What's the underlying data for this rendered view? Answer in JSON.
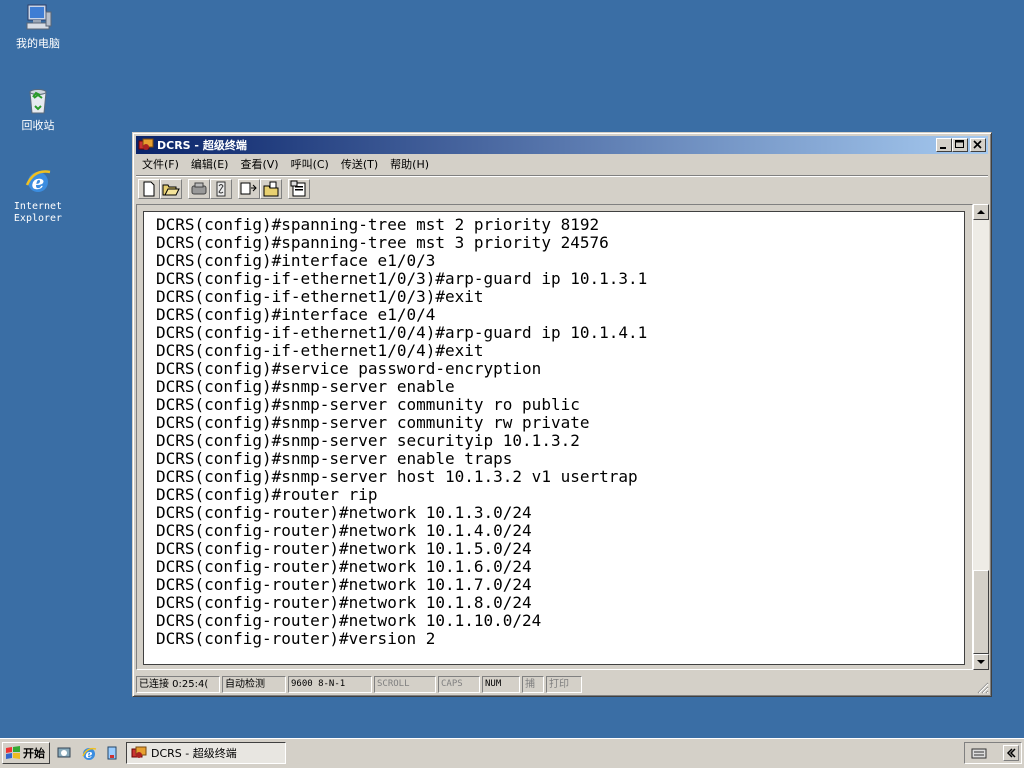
{
  "desktop": {
    "icons": [
      {
        "label": "我的电脑",
        "icon": "my-computer-icon"
      },
      {
        "label": "回收站",
        "icon": "recycle-bin-icon"
      },
      {
        "label": "Internet\nExplorer",
        "icon": "internet-explorer-icon"
      }
    ]
  },
  "window": {
    "title": "DCRS - 超级终端",
    "controls": {
      "minimize": "_",
      "maximize": "□",
      "close": "×"
    },
    "menu": [
      "文件(F)",
      "编辑(E)",
      "查看(V)",
      "呼叫(C)",
      "传送(T)",
      "帮助(H)"
    ],
    "toolbar": [
      "new-icon",
      "open-icon",
      "disconnect-icon",
      "connect-icon",
      "send-icon",
      "receive-icon",
      "properties-icon"
    ],
    "terminal_lines": [
      "DCRS(config)#spanning-tree mst 2 priority 8192",
      "DCRS(config)#spanning-tree mst 3 priority 24576",
      "DCRS(config)#interface e1/0/3",
      "DCRS(config-if-ethernet1/0/3)#arp-guard ip 10.1.3.1",
      "DCRS(config-if-ethernet1/0/3)#exit",
      "DCRS(config)#interface e1/0/4",
      "DCRS(config-if-ethernet1/0/4)#arp-guard ip 10.1.4.1",
      "DCRS(config-if-ethernet1/0/4)#exit",
      "DCRS(config)#service password-encryption",
      "DCRS(config)#snmp-server enable",
      "DCRS(config)#snmp-server community ro public",
      "DCRS(config)#snmp-server community rw private",
      "DCRS(config)#snmp-server securityip 10.1.3.2",
      "DCRS(config)#snmp-server enable traps",
      "DCRS(config)#snmp-server host 10.1.3.2 v1 usertrap",
      "DCRS(config)#router rip",
      "DCRS(config-router)#network 10.1.3.0/24",
      "DCRS(config-router)#network 10.1.4.0/24",
      "DCRS(config-router)#network 10.1.5.0/24",
      "DCRS(config-router)#network 10.1.6.0/24",
      "DCRS(config-router)#network 10.1.7.0/24",
      "DCRS(config-router)#network 10.1.8.0/24",
      "DCRS(config-router)#network 10.1.10.0/24",
      "DCRS(config-router)#version 2"
    ],
    "status": {
      "connected": "已连接 0:25:4(",
      "detect": "自动检测",
      "baud": "9600 8-N-1",
      "scroll": "SCROLL",
      "caps": "CAPS",
      "num": "NUM",
      "capture": "捕",
      "print": "打印"
    }
  },
  "taskbar": {
    "start_label": "开始",
    "task_label": "DCRS - 超级终端",
    "quick_launch": [
      "desktop-icon",
      "ie-icon",
      "media-icon"
    ]
  },
  "colors": {
    "desktop": "#3a6ea5",
    "title_gradient_start": "#0a246a",
    "title_gradient_end": "#a6caf0",
    "face": "#d4d0c8"
  }
}
